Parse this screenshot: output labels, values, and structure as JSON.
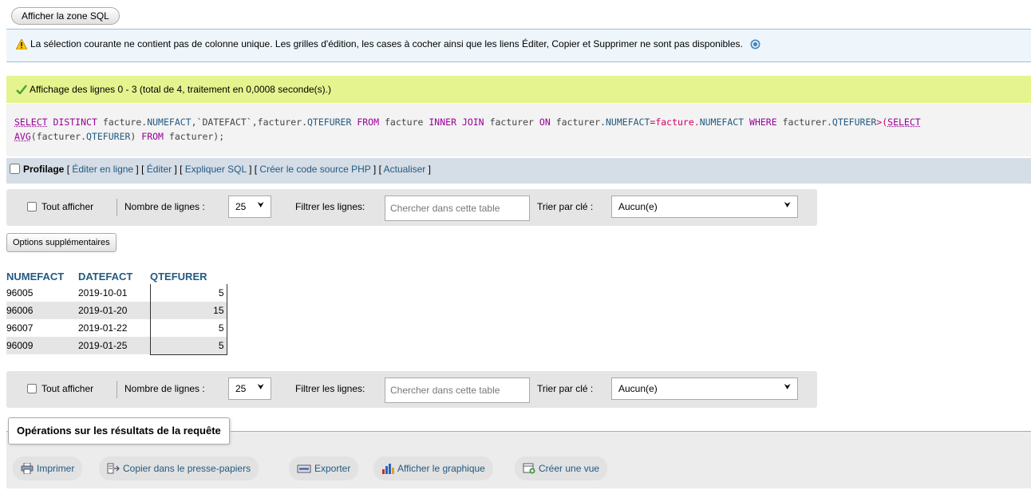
{
  "toggle_sql_label": "Afficher la zone SQL",
  "notice": {
    "text": "La sélection courante ne contient pas de colonne unique. Les grilles d'édition, les cases à cocher ainsi que les liens Éditer, Copier et Supprimer ne sont pas disponibles."
  },
  "success": {
    "text": "Affichage des lignes 0 - 3 (total de 4, traitement en 0,0008 seconde(s).)"
  },
  "sql": {
    "line1_parts": [
      "SELECT",
      "DISTINCT",
      "facture.",
      "NUMEFACT",
      ",`DATEFACT`,facturer.",
      "QTEFURER",
      "FROM",
      "facture",
      "INNER JOIN",
      "facturer",
      "ON",
      "facturer.",
      "NUMEFACT",
      "=facture.",
      "NUMEFACT",
      "WHERE",
      "facturer.",
      "QTEFURER",
      ">(",
      "SELECT"
    ],
    "line2_parts": [
      "AVG",
      "(facturer.",
      "QTEFURER",
      ") ",
      "FROM",
      " facturer);"
    ]
  },
  "profiling": {
    "label": "Profilage",
    "links": [
      "Éditer en ligne",
      "Éditer",
      "Expliquer SQL",
      "Créer le code source PHP",
      "Actualiser"
    ]
  },
  "nav": {
    "show_all": "Tout afficher",
    "rows_label": "Nombre de lignes :",
    "rows_value": "25",
    "filter_label": "Filtrer les lignes:",
    "filter_placeholder": "Chercher dans cette table",
    "sort_label": "Trier par clé :",
    "sort_value": "Aucun(e)"
  },
  "extra_options_label": "Options supplémentaires",
  "table": {
    "headers": [
      "NUMEFACT",
      "DATEFACT",
      "QTEFURER"
    ],
    "rows": [
      [
        "96005",
        "2019-10-01",
        "5"
      ],
      [
        "96006",
        "2019-01-20",
        "15"
      ],
      [
        "96007",
        "2019-01-22",
        "5"
      ],
      [
        "96009",
        "2019-01-25",
        "5"
      ]
    ]
  },
  "operations": {
    "legend": "Opérations sur les résultats de la requête",
    "buttons": [
      {
        "label": "Imprimer",
        "icon": "printer-icon"
      },
      {
        "label": "Copier dans le presse-papiers",
        "icon": "copy-clipboard-icon"
      },
      {
        "label": "Exporter",
        "icon": "export-icon"
      },
      {
        "label": "Afficher le graphique",
        "icon": "bar-chart-icon"
      },
      {
        "label": "Créer une vue",
        "icon": "create-view-icon"
      }
    ]
  }
}
